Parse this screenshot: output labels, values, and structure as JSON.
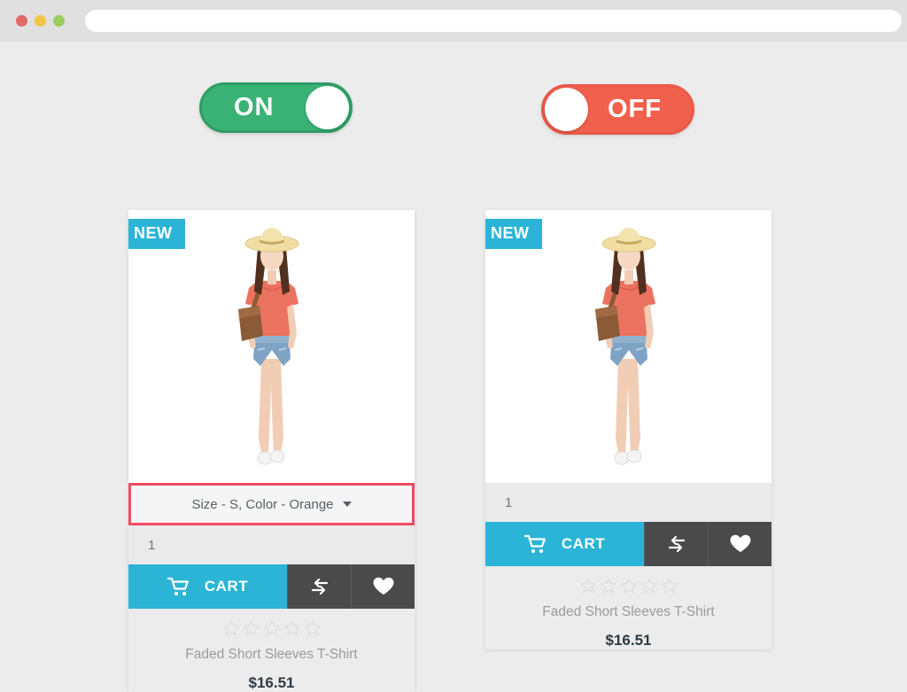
{
  "browser": {
    "traffic_lights": [
      "close",
      "minimize",
      "maximize"
    ],
    "address_value": "",
    "address_placeholder": ""
  },
  "toggles": [
    {
      "id": "toggle-on",
      "label": "ON",
      "state": "on",
      "color": "#3ab276",
      "border": "#2f9c66"
    },
    {
      "id": "toggle-off",
      "label": "OFF",
      "state": "off",
      "color": "#f0604d",
      "border": "#e9594a"
    }
  ],
  "colors": {
    "accent_cyan": "#2bb4d6",
    "dark_button": "#4a4a4a",
    "highlight_border": "#ef4b63",
    "page_bg": "#ececec",
    "price_text": "#2f3a45",
    "title_text": "#9b9b9b"
  },
  "products": [
    {
      "badge": "NEW",
      "has_attribute_select": true,
      "attribute_label": "Size - S, Color - Orange",
      "attribute_highlighted": true,
      "quantity_value": "1",
      "quantity_placeholder": "1",
      "cart_label": "CART",
      "compare_icon": "compare-arrows-icon",
      "wishlist_icon": "heart-icon",
      "rating_stars": 5,
      "rating_filled": 0,
      "title": "Faded Short Sleeves T-Shirt",
      "price": "$16.51"
    },
    {
      "badge": "NEW",
      "has_attribute_select": false,
      "attribute_label": "",
      "attribute_highlighted": false,
      "quantity_value": "1",
      "quantity_placeholder": "1",
      "cart_label": "CART",
      "compare_icon": "compare-arrows-icon",
      "wishlist_icon": "heart-icon",
      "rating_stars": 5,
      "rating_filled": 0,
      "title": "Faded Short Sleeves T-Shirt",
      "price": "$16.51"
    }
  ]
}
